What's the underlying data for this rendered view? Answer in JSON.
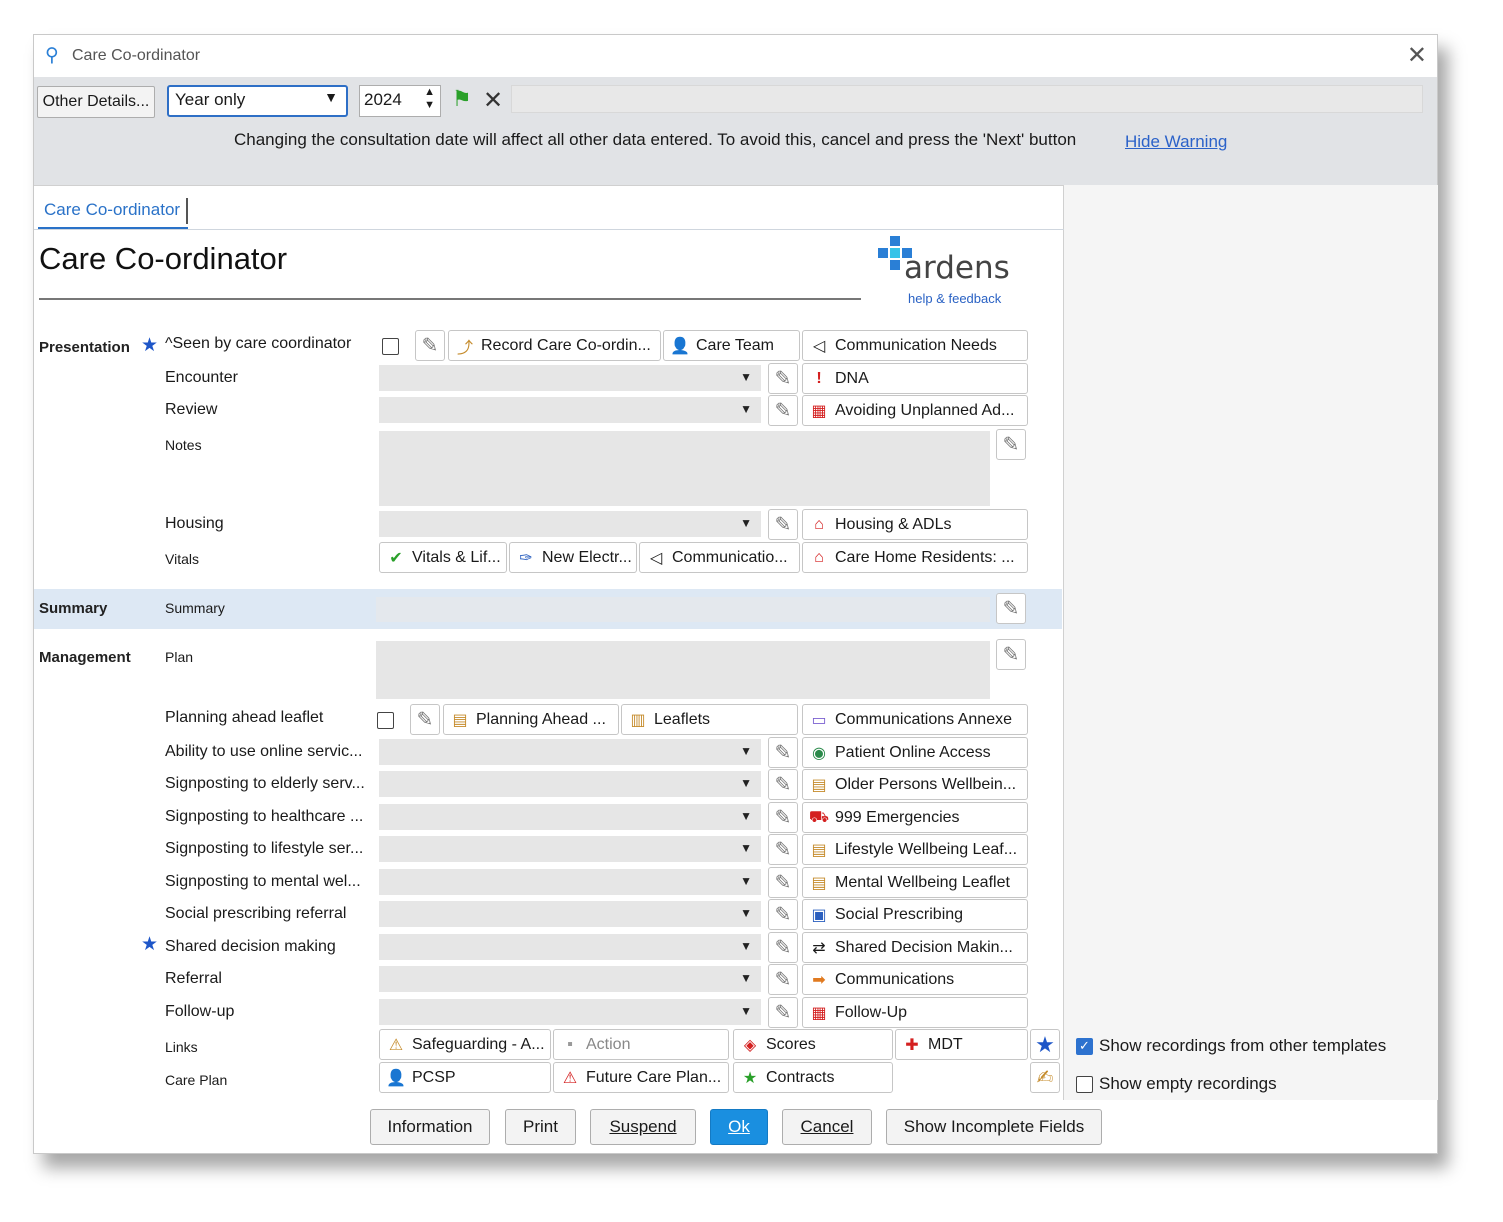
{
  "window": {
    "title": "Care Co-ordinator"
  },
  "toolbar": {
    "other_details_label": "Other Details...",
    "date_mode": "Year only",
    "year": "2024",
    "warning": "Changing the consultation date will affect all other data entered. To avoid this, cancel and press the 'Next' button",
    "hide_warning": "Hide Warning"
  },
  "tab": {
    "label": "Care Co-ordinator"
  },
  "form": {
    "title": "Care Co-ordinator"
  },
  "logo": {
    "word": "ardens",
    "help": "help & feedback"
  },
  "sections": {
    "presentation": "Presentation",
    "summary": "Summary",
    "management": "Management"
  },
  "labels": {
    "seen": "^Seen by care coordinator",
    "encounter": "Encounter",
    "review": "Review",
    "notes": "Notes",
    "housing": "Housing",
    "vitals": "Vitals",
    "summary": "Summary",
    "plan": "Plan",
    "planning_leaflet": "Planning ahead leaflet",
    "online": "Ability to use online servic...",
    "elderly": "Signposting to elderly serv...",
    "healthcare": "Signposting to healthcare ...",
    "lifestyle": "Signposting to lifestyle ser...",
    "mental": "Signposting to mental wel...",
    "social": "Social prescribing referral",
    "shared": "Shared decision making",
    "referral": "Referral",
    "followup": "Follow-up",
    "links": "Links",
    "careplan": "Care Plan"
  },
  "buttons": {
    "record_care": "Record Care Co-ordin...",
    "care_team": "Care Team",
    "comm_needs": "Communication Needs",
    "dna": "DNA",
    "avoiding": "Avoiding Unplanned Ad...",
    "housing_adls": "Housing & ADLs",
    "vitals_lif": "Vitals & Lif...",
    "new_electr": "New Electr...",
    "communicatio": "Communicatio...",
    "care_home": "Care Home Residents: ...",
    "planning_ahead": "Planning Ahead ...",
    "leaflets": "Leaflets",
    "comm_annexe": "Communications Annexe",
    "patient_online": "Patient Online Access",
    "older_persons": "Older Persons Wellbein...",
    "emergencies": "999 Emergencies",
    "lifestyle_leaf": "Lifestyle Wellbeing Leaf...",
    "mental_leaflet": "Mental Wellbeing Leaflet",
    "social_prescribing": "Social Prescribing",
    "shared_decision": "Shared Decision Makin...",
    "communications": "Communications",
    "follow_up": "Follow-Up",
    "safeguarding": "Safeguarding - A...",
    "action": "Action",
    "scores": "Scores",
    "mdt": "MDT",
    "pcsp": "PCSP",
    "future_care": "Future Care Plan...",
    "contracts": "Contracts"
  },
  "right_panel": {
    "show_other": "Show recordings from other templates",
    "show_empty": "Show empty recordings"
  },
  "footer": {
    "information": "Information",
    "print": "Print",
    "suspend": "Suspend",
    "ok": "Ok",
    "cancel": "Cancel",
    "incomplete": "Show Incomplete Fields"
  }
}
